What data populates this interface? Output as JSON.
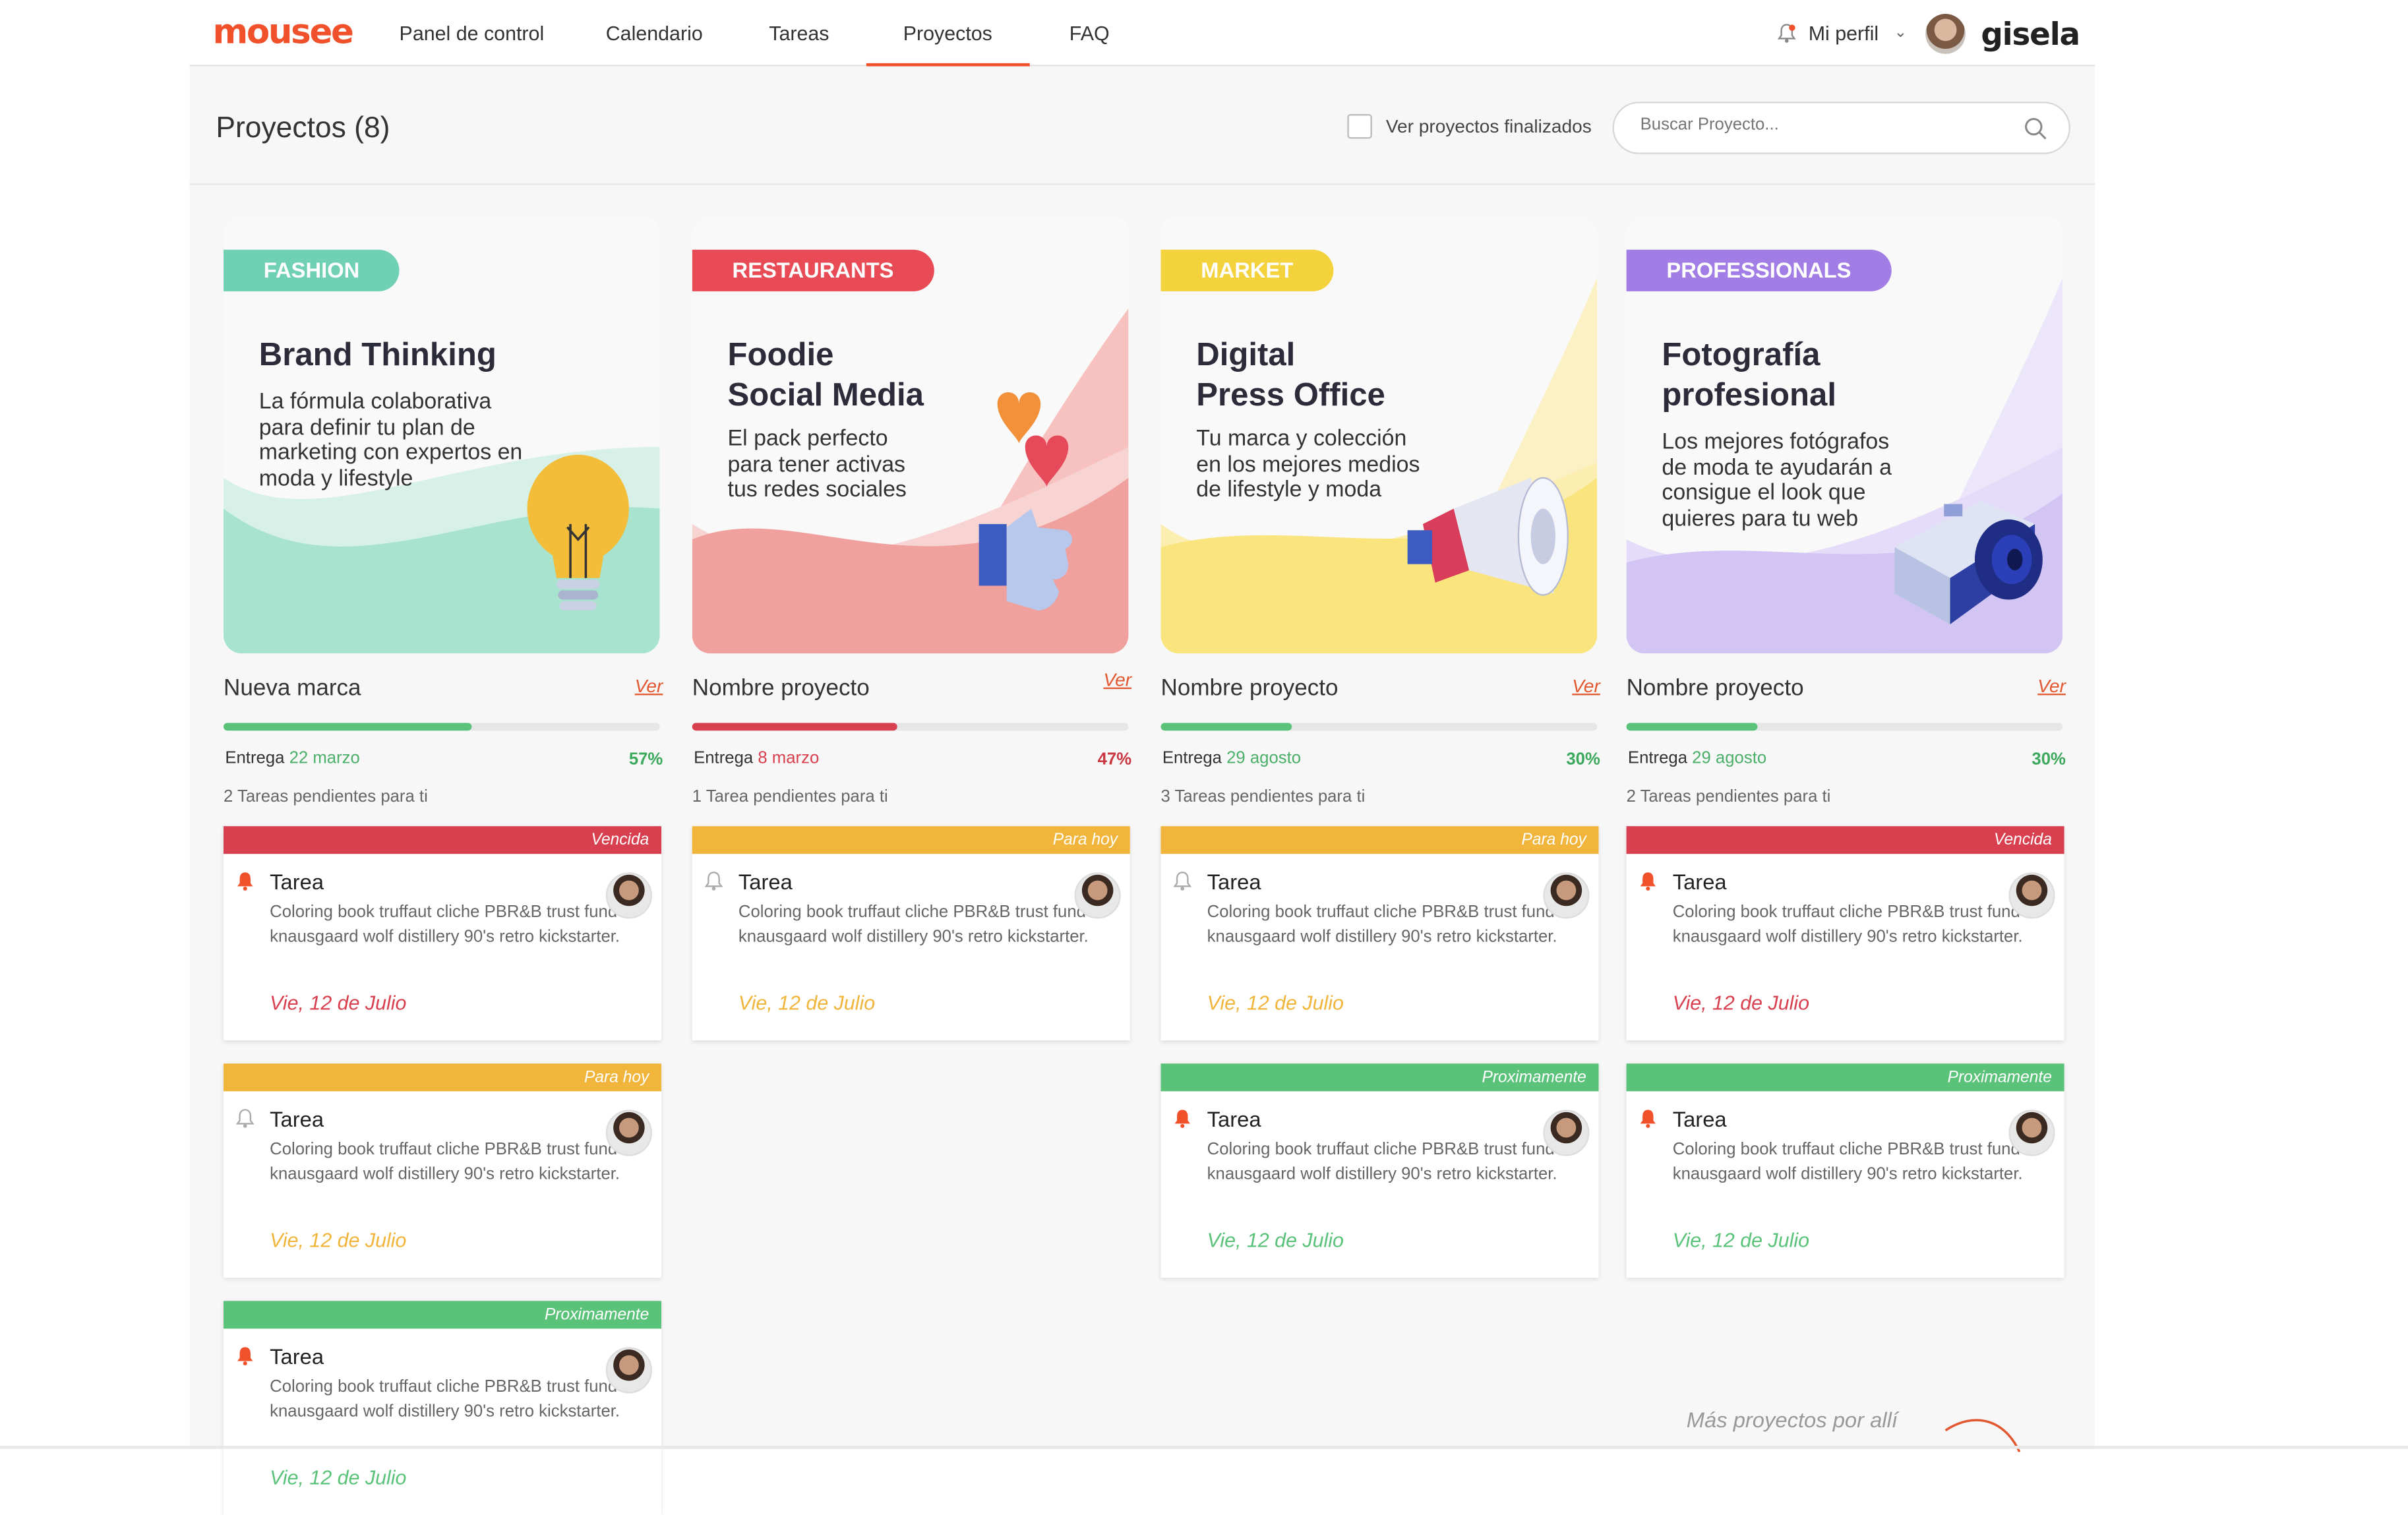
{
  "app": {
    "logo": "mousee",
    "brand_right": "gisela"
  },
  "nav": {
    "items": [
      "Panel de control",
      "Calendario",
      "Tareas",
      "Proyectos",
      "FAQ"
    ],
    "active": "Proyectos"
  },
  "profile": {
    "label": "Mi perfil"
  },
  "header": {
    "title": "Proyectos (8)",
    "show_finished_label": "Ver proyectos finalizados",
    "search_placeholder": "Buscar Proyecto..."
  },
  "colors": {
    "accent": "#f0502a",
    "red": "#d9404f",
    "yellow": "#f0b53a",
    "green": "#5bc27a",
    "purple": "#a27de6",
    "teal": "#6fd0b4"
  },
  "projects": [
    {
      "tag": "FASHION",
      "title_l1": "Brand Thinking",
      "title_l2": "",
      "desc": [
        "La fórmula colaborativa",
        "para definir tu plan de",
        "marketing con expertos en",
        "moda y lifestyle"
      ],
      "name": "Nueva marca",
      "ver": "Ver",
      "progress": 0.57,
      "pct": "57%",
      "entrega_label": "Entrega",
      "entrega_date": "22 marzo",
      "pending": "2 Tareas pendientes para ti",
      "tasks": [
        {
          "status": "Vencida",
          "title": "Tarea",
          "desc": "Coloring book truffaut cliche PBR&B trust fund knausgaard wolf distillery 90's retro kickstarter.",
          "date": "Vie, 12 de Julio"
        },
        {
          "status": "Para hoy",
          "title": "Tarea",
          "desc": "Coloring book truffaut cliche PBR&B trust fund knausgaard wolf distillery 90's retro kickstarter.",
          "date": "Vie, 12 de Julio"
        },
        {
          "status": "Proximamente",
          "title": "Tarea",
          "desc": "Coloring book truffaut cliche PBR&B trust fund knausgaard wolf distillery 90's retro kickstarter.",
          "date": "Vie, 12 de Julio"
        }
      ]
    },
    {
      "tag": "RESTAURANTS",
      "title_l1": "Foodie",
      "title_l2": "Social Media",
      "desc": [
        "El pack perfecto",
        "para tener activas",
        "tus redes sociales"
      ],
      "name": "Nombre proyecto",
      "ver": "Ver",
      "progress": 0.47,
      "pct": "47%",
      "entrega_label": "Entrega",
      "entrega_date": "8 marzo",
      "pending": "1 Tarea pendientes para ti",
      "tasks": [
        {
          "status": "Para hoy",
          "title": "Tarea",
          "desc": "Coloring book truffaut cliche PBR&B trust fund knausgaard wolf distillery 90's retro kickstarter.",
          "date": "Vie, 12 de Julio"
        }
      ]
    },
    {
      "tag": "MARKET",
      "title_l1": "Digital",
      "title_l2": "Press Office",
      "desc": [
        "Tu marca y colección",
        "en los mejores medios",
        "de lifestyle y moda"
      ],
      "name": "Nombre proyecto",
      "ver": "Ver",
      "progress": 0.3,
      "pct": "30%",
      "entrega_label": "Entrega",
      "entrega_date": "29 agosto",
      "pending": "3 Tareas pendientes para ti",
      "tasks": [
        {
          "status": "Para hoy",
          "title": "Tarea",
          "desc": "Coloring book truffaut cliche PBR&B trust fund knausgaard wolf distillery 90's retro kickstarter.",
          "date": "Vie, 12 de Julio"
        },
        {
          "status": "Proximamente",
          "title": "Tarea",
          "desc": "Coloring book truffaut cliche PBR&B trust fund knausgaard wolf distillery 90's retro kickstarter.",
          "date": "Vie, 12 de Julio"
        }
      ]
    },
    {
      "tag": "PROFESSIONALS",
      "title_l1": "Fotografía",
      "title_l2": "profesional",
      "desc": [
        "Los mejores fotógrafos",
        "de moda te ayudarán a",
        "consigue el look que",
        "quieres para tu web"
      ],
      "name": "Nombre proyecto",
      "ver": "Ver",
      "progress": 0.3,
      "pct": "30%",
      "entrega_label": "Entrega",
      "entrega_date": "29 agosto",
      "pending": "2 Tareas pendientes para ti",
      "tasks": [
        {
          "status": "Vencida",
          "title": "Tarea",
          "desc": "Coloring book truffaut cliche PBR&B trust fund knausgaard wolf distillery 90's retro kickstarter.",
          "date": "Vie, 12 de Julio"
        },
        {
          "status": "Proximamente",
          "title": "Tarea",
          "desc": "Coloring book truffaut cliche PBR&B trust fund knausgaard wolf distillery 90's retro kickstarter.",
          "date": "Vie, 12 de Julio"
        }
      ]
    }
  ],
  "footer": {
    "more_projects": "Más proyectos por allí"
  }
}
